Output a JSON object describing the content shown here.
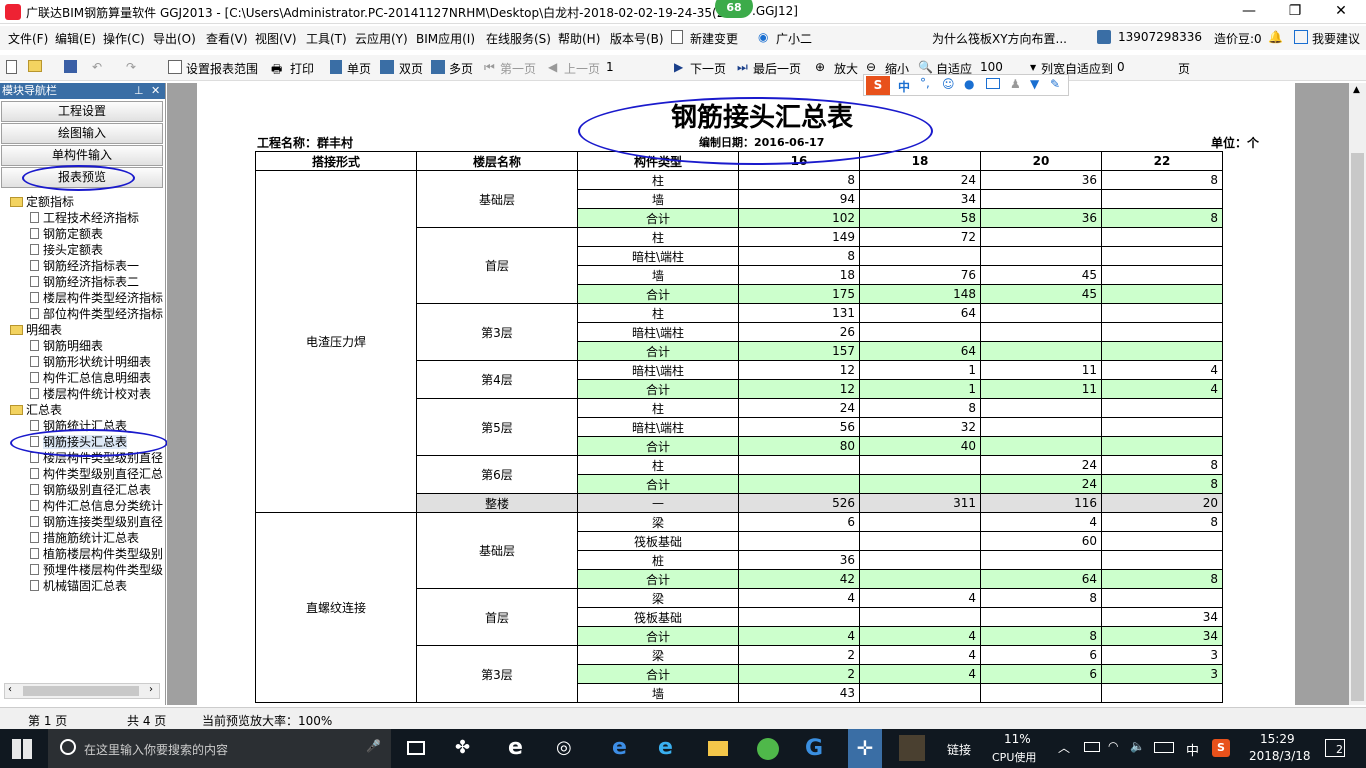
{
  "app": {
    "title": "广联达BIM钢筋算量软件 GGJ2013 - [C:\\Users\\Administrator.PC-20141127NRHM\\Desktop\\白龙村-2018-02-02-19-24-35(20",
    "title_suffix": ".GGJ12]",
    "badge": "68"
  },
  "menu": [
    "文件(F)",
    "编辑(E)",
    "操作(C)",
    "导出(O)",
    "查看(V)",
    "视图(V)",
    "工具(T)",
    "云应用(Y)",
    "BIM应用(I)",
    "在线服务(S)",
    "帮助(H)",
    "版本号(B)",
    "新建变更",
    "广小二",
    "为什么筏板XY方向布置...",
    "13907298336",
    "造价豆:0",
    "我要建议"
  ],
  "toolbar": {
    "set_range": "设置报表范围",
    "print": "打印",
    "single": "单页",
    "double": "双页",
    "multi": "多页",
    "first": "第一页",
    "prev": "上一页",
    "page": "1",
    "next": "下一页",
    "last": "最后一页",
    "zoom_in": "放大",
    "zoom_out": "缩小",
    "fit": "自适应",
    "zoom_value": "100",
    "col_fit": "列宽自适应到",
    "col_value": "0",
    "page_unit": "页"
  },
  "sidebar": {
    "header": "模块导航栏",
    "buttons": [
      "工程设置",
      "绘图输入",
      "单构件输入",
      "报表预览"
    ],
    "groups": [
      {
        "label": "定额指标",
        "items": [
          "工程技术经济指标",
          "钢筋定额表",
          "接头定额表",
          "钢筋经济指标表一",
          "钢筋经济指标表二",
          "楼层构件类型经济指标",
          "部位构件类型经济指标"
        ]
      },
      {
        "label": "明细表",
        "items": [
          "钢筋明细表",
          "钢筋形状统计明细表",
          "构件汇总信息明细表",
          "楼层构件统计校对表"
        ]
      },
      {
        "label": "汇总表",
        "items": [
          "钢筋统计汇总表",
          "钢筋接头汇总表",
          "楼层构件类型级别直径",
          "构件类型级别直径汇总",
          "钢筋级别直径汇总表",
          "构件汇总信息分类统计",
          "钢筋连接类型级别直径",
          "措施筋统计汇总表",
          "植筋楼层构件类型级别",
          "预埋件楼层构件类型级",
          "机械锚固汇总表"
        ]
      }
    ]
  },
  "report": {
    "title": "钢筋接头汇总表",
    "project": "工程名称：群丰村",
    "date": "编制日期：2016-06-17",
    "unit": "单位：个",
    "headers": [
      "搭接形式",
      "楼层名称",
      "构件类型",
      "16",
      "18",
      "20",
      "22"
    ],
    "rows": [
      [
        "电渣压力焊",
        "基础层",
        "柱",
        "8",
        "24",
        "36",
        "8"
      ],
      [
        "",
        "",
        "墙",
        "94",
        "34",
        "",
        ""
      ],
      [
        "",
        "",
        "合计",
        "102",
        "58",
        "36",
        "8"
      ],
      [
        "",
        "首层",
        "柱",
        "149",
        "72",
        "",
        ""
      ],
      [
        "",
        "",
        "暗柱\\端柱",
        "8",
        "",
        "",
        ""
      ],
      [
        "",
        "",
        "墙",
        "18",
        "76",
        "45",
        ""
      ],
      [
        "",
        "",
        "合计",
        "175",
        "148",
        "45",
        ""
      ],
      [
        "",
        "第3层",
        "柱",
        "131",
        "64",
        "",
        ""
      ],
      [
        "",
        "",
        "暗柱\\端柱",
        "26",
        "",
        "",
        ""
      ],
      [
        "",
        "",
        "合计",
        "157",
        "64",
        "",
        ""
      ],
      [
        "",
        "第4层",
        "暗柱\\端柱",
        "12",
        "1",
        "11",
        "4"
      ],
      [
        "",
        "",
        "合计",
        "12",
        "1",
        "11",
        "4"
      ],
      [
        "",
        "第5层",
        "柱",
        "24",
        "8",
        "",
        ""
      ],
      [
        "",
        "",
        "暗柱\\端柱",
        "56",
        "32",
        "",
        ""
      ],
      [
        "",
        "",
        "合计",
        "80",
        "40",
        "",
        ""
      ],
      [
        "",
        "第6层",
        "柱",
        "",
        "",
        "24",
        "8"
      ],
      [
        "",
        "",
        "合计",
        "",
        "",
        "24",
        "8"
      ],
      [
        "",
        "整楼",
        "—",
        "526",
        "311",
        "116",
        "20"
      ],
      [
        "直螺纹连接",
        "基础层",
        "梁",
        "6",
        "",
        "4",
        "8"
      ],
      [
        "",
        "",
        "筏板基础",
        "",
        "",
        "60",
        ""
      ],
      [
        "",
        "",
        "桩",
        "36",
        "",
        "",
        ""
      ],
      [
        "",
        "",
        "合计",
        "42",
        "",
        "64",
        "8"
      ],
      [
        "",
        "首层",
        "梁",
        "4",
        "4",
        "8",
        ""
      ],
      [
        "",
        "",
        "筏板基础",
        "",
        "",
        "",
        "34"
      ],
      [
        "",
        "",
        "合计",
        "4",
        "4",
        "8",
        "34"
      ],
      [
        "",
        "第3层",
        "梁",
        "2",
        "4",
        "6",
        "3"
      ],
      [
        "",
        "",
        "合计",
        "2",
        "4",
        "6",
        "3"
      ],
      [
        "",
        "",
        "墙",
        "43",
        "",
        "",
        ""
      ]
    ]
  },
  "status": {
    "page": "第 1 页",
    "total": "共 4 页",
    "zoom": "当前预览放大率：100%"
  },
  "taskbar": {
    "search": "在这里输入你要搜索的内容",
    "link": "链接",
    "cpu": "11%",
    "cpu_label": "CPU使用",
    "ime": "中",
    "time": "15:29",
    "date": "2018/3/18",
    "notif": "2"
  }
}
